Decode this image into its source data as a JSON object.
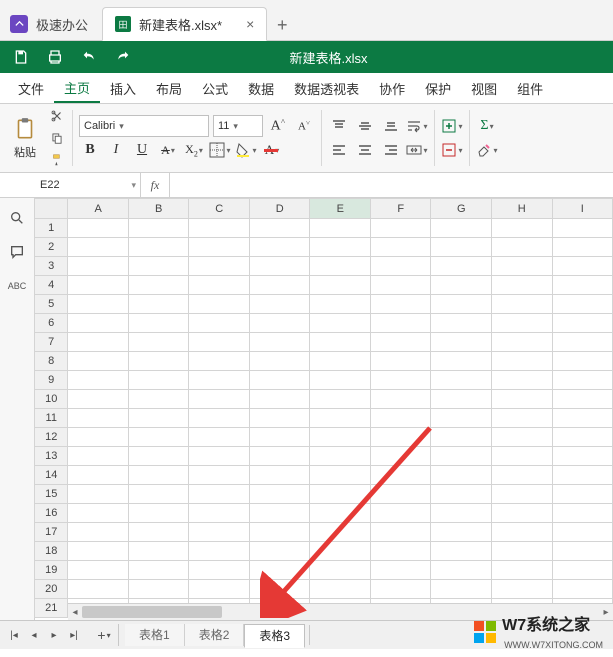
{
  "top_tabs": {
    "home_label": "极速办公",
    "file_tab_label": "新建表格.xlsx*",
    "file_icon_text": "田"
  },
  "title_bar": {
    "document_name": "新建表格.xlsx"
  },
  "menu": {
    "items": [
      "文件",
      "主页",
      "插入",
      "布局",
      "公式",
      "数据",
      "数据透视表",
      "协作",
      "保护",
      "视图",
      "组件"
    ],
    "active_index": 1
  },
  "ribbon": {
    "paste_label": "粘贴",
    "font_name": "Calibri",
    "font_size": "11",
    "bold": "B",
    "italic": "I",
    "underline": "U",
    "font_larger": "A",
    "font_smaller": "A"
  },
  "name_box": {
    "value": "E22",
    "fx_label": "fx",
    "formula": ""
  },
  "grid": {
    "columns": [
      "A",
      "B",
      "C",
      "D",
      "E",
      "F",
      "G",
      "H",
      "I"
    ],
    "rows": [
      "1",
      "2",
      "3",
      "4",
      "5",
      "6",
      "7",
      "8",
      "9",
      "10",
      "11",
      "12",
      "13",
      "14",
      "15",
      "16",
      "17",
      "18",
      "19",
      "20",
      "21"
    ],
    "selected_col_index": 4
  },
  "left_tools": {
    "abc_label": "ABC"
  },
  "sheet_tabs": {
    "items": [
      "表格1",
      "表格2",
      "表格3"
    ],
    "active_index": 2
  },
  "watermark": {
    "text": "W7系统之家",
    "sub": "WWW.W7XITONG.COM"
  }
}
